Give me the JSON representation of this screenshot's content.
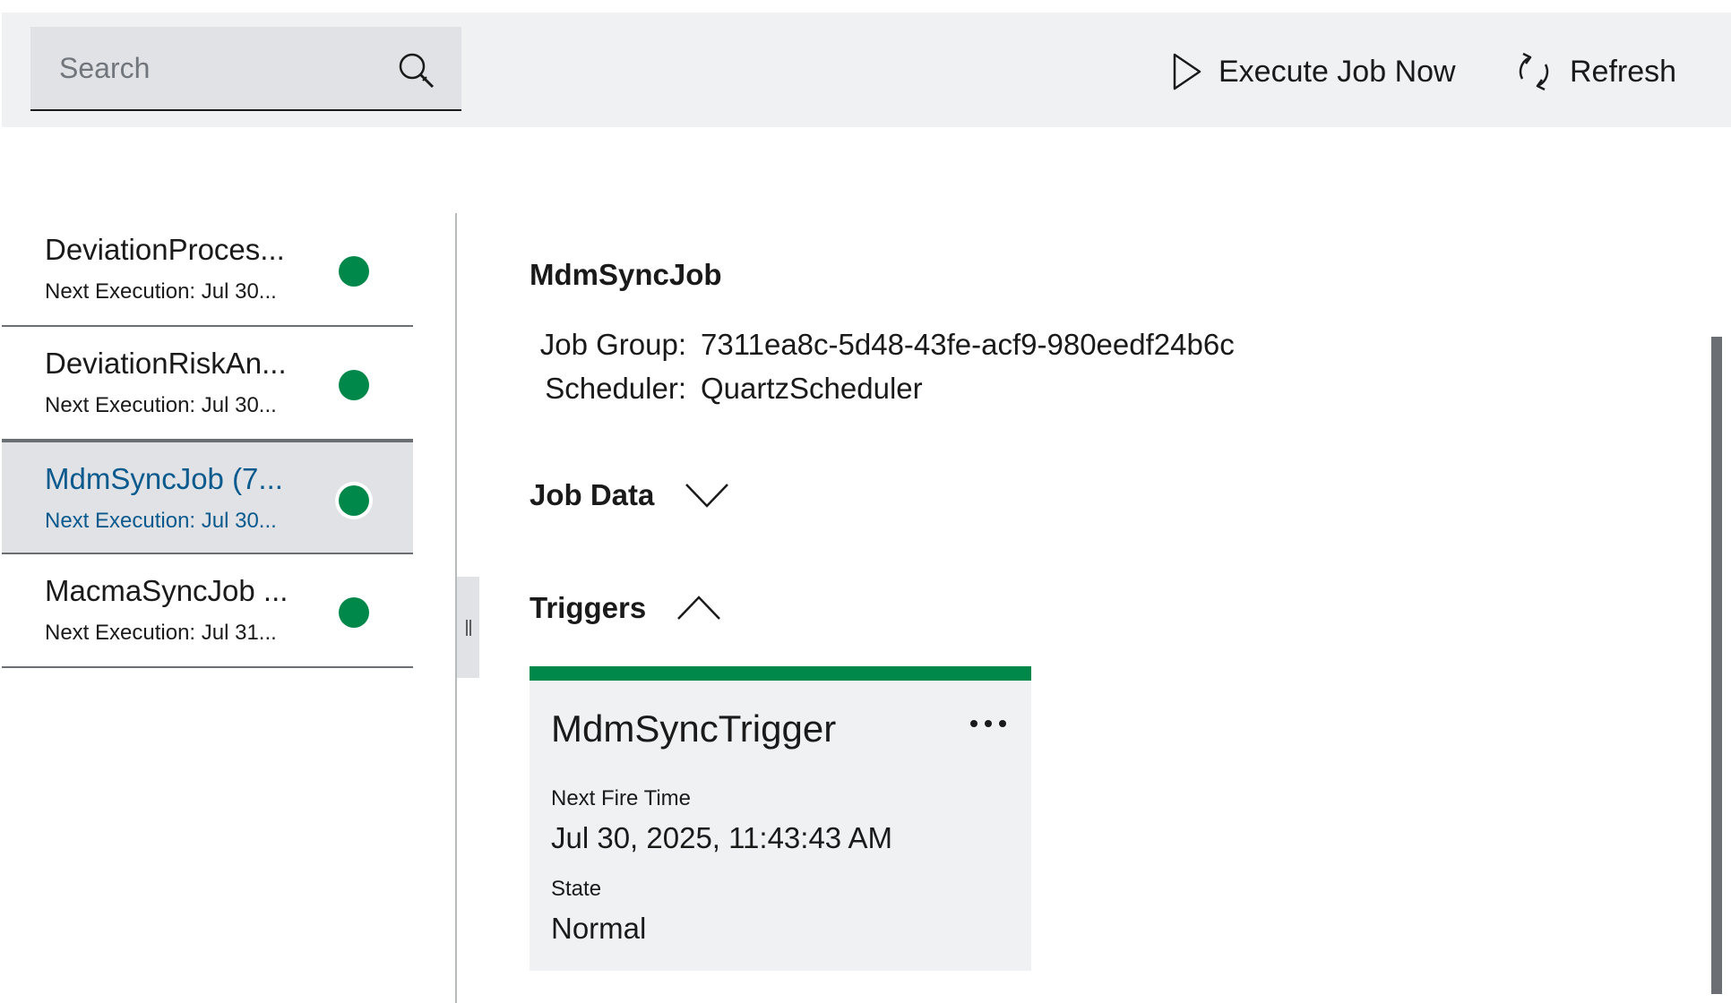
{
  "toolbar": {
    "search": {
      "placeholder": "Search",
      "value": ""
    },
    "execute_label": "Execute Job Now",
    "refresh_label": "Refresh"
  },
  "job_list": {
    "items": [
      {
        "name": "DeviationProces...",
        "next_execution": "Next Execution: Jul 30...",
        "status": "active",
        "selected": false
      },
      {
        "name": "DeviationRiskAn...",
        "next_execution": "Next Execution: Jul 30...",
        "status": "active",
        "selected": false
      },
      {
        "name": "MdmSyncJob (7...",
        "next_execution": "Next Execution: Jul 30...",
        "status": "active",
        "selected": true
      },
      {
        "name": "MacmaSyncJob ...",
        "next_execution": "Next Execution: Jul 31...",
        "status": "active",
        "selected": false
      }
    ]
  },
  "detail": {
    "title": "MdmSyncJob",
    "job_group_label": "Job Group:",
    "job_group_value": "7311ea8c-5d48-43fe-acf9-980eedf24b6c",
    "scheduler_label": "Scheduler:",
    "scheduler_value": "QuartzScheduler",
    "job_data_label": "Job Data",
    "triggers_label": "Triggers",
    "trigger": {
      "name": "MdmSyncTrigger",
      "next_fire_label": "Next Fire Time",
      "next_fire_value": "Jul 30, 2025, 11:43:43 AM",
      "state_label": "State",
      "state_value": "Normal"
    }
  },
  "colors": {
    "accent_green": "#00884a",
    "selected_text": "#0a5a8e",
    "toolbar_bg": "#eff1f2"
  },
  "icons": {
    "search": "search-icon",
    "execute": "play-icon",
    "refresh": "refresh-icon",
    "job_data_toggle": "chevron-down-icon",
    "triggers_toggle": "chevron-up-icon",
    "trigger_menu": "more-icon"
  }
}
